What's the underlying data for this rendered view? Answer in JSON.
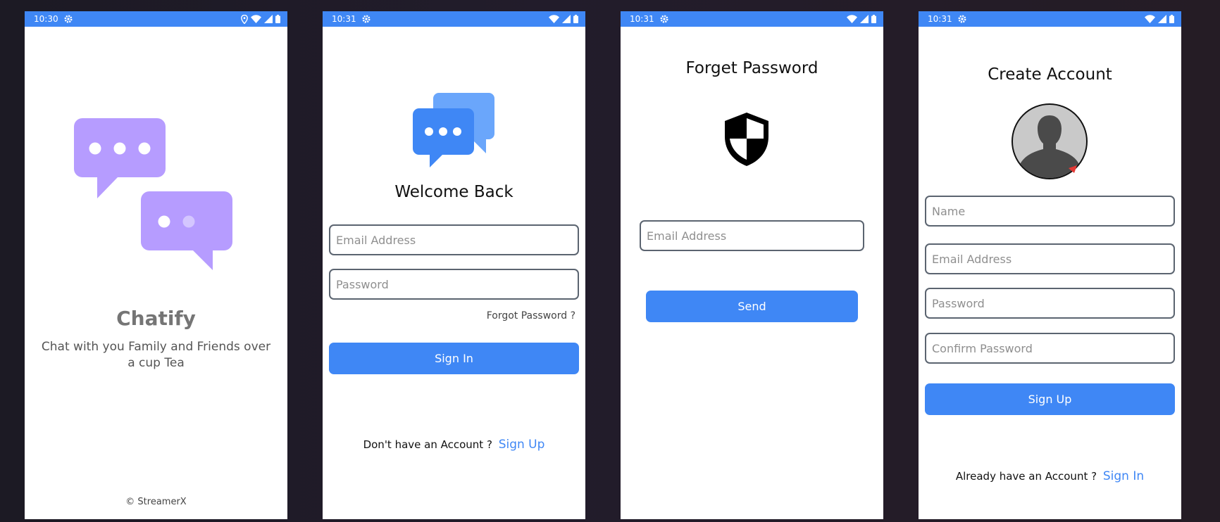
{
  "status_times": [
    "10:30",
    "10:31",
    "10:31",
    "10:31"
  ],
  "splash": {
    "app_name": "Chatify",
    "tagline": "Chat with you Family and Friends over a cup Tea",
    "footer": "© StreamerX"
  },
  "login": {
    "title": "Welcome Back",
    "email_placeholder": "Email Address",
    "password_placeholder": "Password",
    "forgot_label": "Forgot Password ?",
    "signin_label": "Sign In",
    "no_account_text": "Don't have an Account ?",
    "signup_link": "Sign Up"
  },
  "forget": {
    "title": "Forget Password",
    "email_placeholder": "Email Address",
    "send_label": "Send"
  },
  "register": {
    "title": "Create Account",
    "name_placeholder": "Name",
    "email_placeholder": "Email Address",
    "password_placeholder": "Password",
    "confirm_placeholder": "Confirm Password",
    "signup_label": "Sign Up",
    "have_account_text": "Already have an Account ?",
    "signin_link": "Sign In"
  },
  "icons": {
    "status": [
      "gear-icon",
      "location-icon",
      "wifi-icon",
      "signal-icon",
      "battery-icon"
    ],
    "splash": "chat-bubbles-icon",
    "login": "chat-bubbles-icon",
    "forget": "shield-icon",
    "register": "avatar-icon"
  },
  "colors": {
    "accent": "#3f87f5",
    "splash_bubble": "#b69cff",
    "title_grey": "#757575",
    "background": "#1f1b27"
  }
}
